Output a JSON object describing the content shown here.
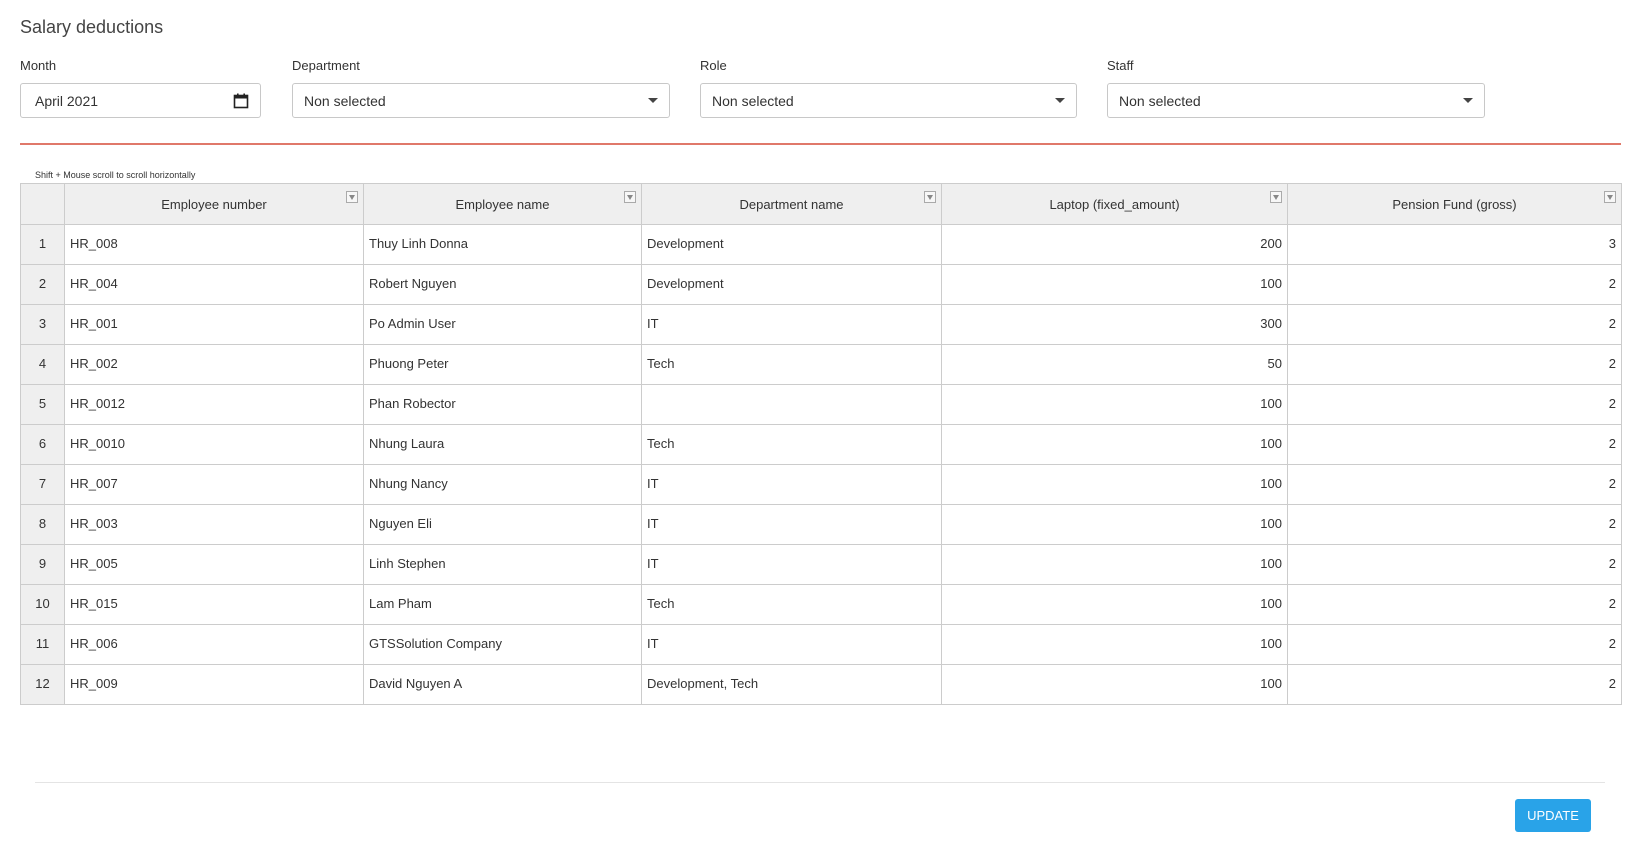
{
  "page": {
    "title": "Salary deductions"
  },
  "filters": {
    "month": {
      "label": "Month",
      "value": "April  2021"
    },
    "department": {
      "label": "Department",
      "value": "Non selected"
    },
    "role": {
      "label": "Role",
      "value": "Non selected"
    },
    "staff": {
      "label": "Staff",
      "value": "Non selected"
    }
  },
  "hint": "Shift + Mouse scroll to scroll horizontally",
  "table": {
    "columns": [
      "Employee number",
      "Employee name",
      "Department name",
      "Laptop (fixed_amount)",
      "Pension Fund (gross)"
    ],
    "rows": [
      {
        "num": "1",
        "emp": "HR_008",
        "name": "Thuy Linh Donna",
        "dept": "Development",
        "laptop": "200",
        "pension": "3"
      },
      {
        "num": "2",
        "emp": "HR_004",
        "name": "Robert Nguyen",
        "dept": "Development",
        "laptop": "100",
        "pension": "2"
      },
      {
        "num": "3",
        "emp": "HR_001",
        "name": "Po Admin User",
        "dept": "IT",
        "laptop": "300",
        "pension": "2"
      },
      {
        "num": "4",
        "emp": "HR_002",
        "name": "Phuong Peter",
        "dept": "Tech",
        "laptop": "50",
        "pension": "2"
      },
      {
        "num": "5",
        "emp": "HR_0012",
        "name": "Phan Robector",
        "dept": "",
        "laptop": "100",
        "pension": "2"
      },
      {
        "num": "6",
        "emp": "HR_0010",
        "name": "Nhung Laura",
        "dept": "Tech",
        "laptop": "100",
        "pension": "2"
      },
      {
        "num": "7",
        "emp": "HR_007",
        "name": "Nhung Nancy",
        "dept": "IT",
        "laptop": "100",
        "pension": "2"
      },
      {
        "num": "8",
        "emp": "HR_003",
        "name": "Nguyen Eli",
        "dept": "IT",
        "laptop": "100",
        "pension": "2"
      },
      {
        "num": "9",
        "emp": "HR_005",
        "name": "Linh Stephen",
        "dept": "IT",
        "laptop": "100",
        "pension": "2"
      },
      {
        "num": "10",
        "emp": "HR_015",
        "name": "Lam Pham",
        "dept": "Tech",
        "laptop": "100",
        "pension": "2"
      },
      {
        "num": "11",
        "emp": "HR_006",
        "name": "GTSSolution Company",
        "dept": "IT",
        "laptop": "100",
        "pension": "2"
      },
      {
        "num": "12",
        "emp": "HR_009",
        "name": "David Nguyen A",
        "dept": "Development, Tech",
        "laptop": "100",
        "pension": "2"
      }
    ]
  },
  "actions": {
    "update_label": "UPDATE"
  },
  "colors": {
    "accent": "#29a3e8",
    "divider": "#e0786a",
    "header_bg": "#efefef"
  },
  "icons": {
    "month": "calendar-icon",
    "dropdown": "caret-down-icon",
    "column_filter": "filter-icon"
  }
}
